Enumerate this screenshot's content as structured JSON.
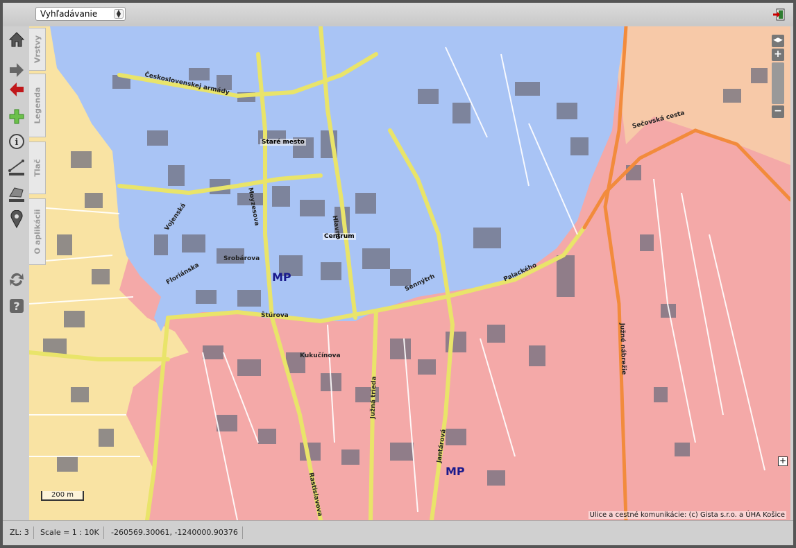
{
  "topbar": {
    "search_select_value": "Vyhľadávanie",
    "logout_icon": "exit-icon"
  },
  "tools": [
    {
      "name": "home-icon"
    },
    {
      "name": "forward-arrow-icon"
    },
    {
      "name": "back-arrow-icon"
    },
    {
      "name": "add-icon"
    },
    {
      "name": "info-icon"
    },
    {
      "name": "measure-line-icon"
    },
    {
      "name": "measure-area-icon"
    },
    {
      "name": "location-pin-icon"
    },
    {
      "name": "refresh-icon"
    },
    {
      "name": "help-icon"
    }
  ],
  "tabs": {
    "layers": "Vrstvy",
    "legend": "Legenda",
    "print": "Tlač",
    "about": "O aplikácii"
  },
  "map": {
    "labels": {
      "mp1": "MP",
      "mp2": "MP",
      "stare_mesto": "Staré mesto",
      "centrum": "Centrum"
    },
    "streets": {
      "s1": "Štúrova",
      "s2": "Moyzesova",
      "s3": "Vojenská",
      "s4": "Palackého",
      "s5": "Južná trieda",
      "s6": "Južné nábrežie",
      "s7": "Sečovská cesta",
      "s8": "Rastislavova",
      "s9": "Jantárová",
      "s10": "Kukučínova",
      "s11": "Československej armády",
      "s12": "Hlavná",
      "s13": "Srobárova",
      "s14": "Floriánska",
      "s15": "Sennýtrh"
    },
    "scale_label": "200 m",
    "attribution": "Ulice a cestné komunikácie: (c) Gista s.r.o. a ÚHA Košice",
    "zoom": {
      "in": "+",
      "out": "−"
    },
    "corner_toggle": "+",
    "colors": {
      "blue": "#a9c4f5",
      "pink": "#f4a9a8",
      "yellow": "#f9e3a3",
      "peach": "#f7c9a8"
    }
  },
  "status": {
    "zoom_level": "ZL: 3",
    "scale": "Scale = 1 : 10K",
    "coordinates": "-260569.30061, -1240000.90376"
  }
}
